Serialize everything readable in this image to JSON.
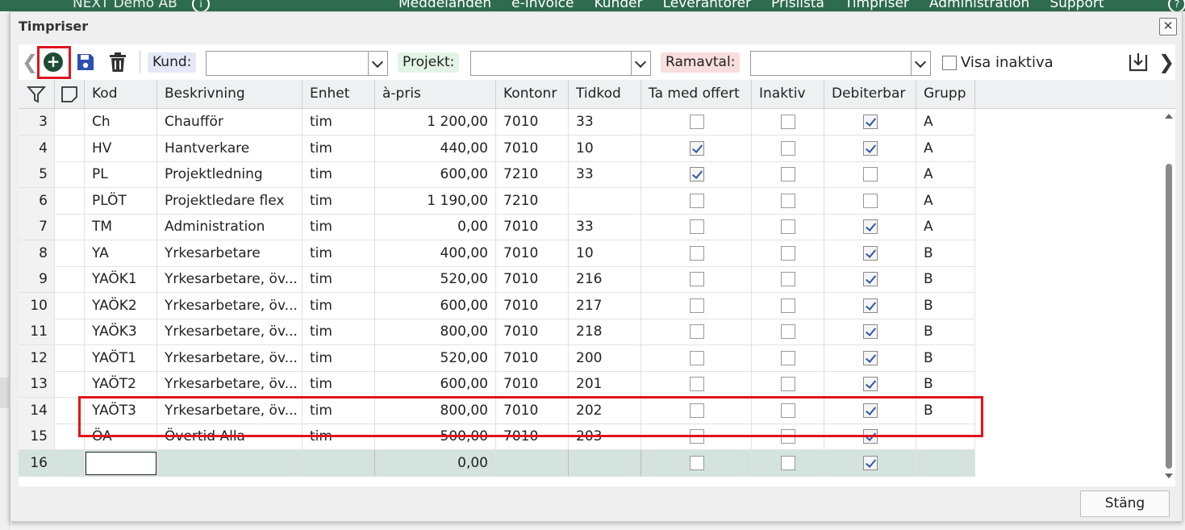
{
  "app_nav": {
    "company": "NEXT Demo AB",
    "menu": [
      "Meddelanden",
      "e-Invoice",
      "Kunder",
      "Leverantörer",
      "Prislista",
      "Timpriser",
      "Administration",
      "Support"
    ]
  },
  "dialog": {
    "title": "Timpriser",
    "close_label": "✕"
  },
  "toolbar": {
    "kund_label": "Kund:",
    "kund_value": "",
    "projekt_label": "Projekt:",
    "projekt_value": "",
    "ramavtal_label": "Ramavtal:",
    "ramavtal_value": "",
    "visa_inaktiva_label": "Visa inaktiva",
    "visa_inaktiva_checked": false
  },
  "grid": {
    "columns": [
      "Kod",
      "Beskrivning",
      "Enhet",
      "à-pris",
      "Kontonr",
      "Tidkod",
      "Ta med offert",
      "Inaktiv",
      "Debiterbar",
      "Grupp"
    ],
    "rows": [
      {
        "n": "3",
        "kod": "Ch",
        "beskrivning": "Chaufför",
        "enhet": "tim",
        "pris": "1 200,00",
        "kontonr": "7010",
        "tidkod": "33",
        "offert": false,
        "inaktiv": false,
        "debiterbar": true,
        "grupp": "A"
      },
      {
        "n": "4",
        "kod": "HV",
        "beskrivning": "Hantverkare",
        "enhet": "tim",
        "pris": "440,00",
        "kontonr": "7010",
        "tidkod": "10",
        "offert": true,
        "inaktiv": false,
        "debiterbar": true,
        "grupp": "A"
      },
      {
        "n": "5",
        "kod": "PL",
        "beskrivning": "Projektledning",
        "enhet": "tim",
        "pris": "600,00",
        "kontonr": "7210",
        "tidkod": "33",
        "offert": true,
        "inaktiv": false,
        "debiterbar": false,
        "grupp": "A"
      },
      {
        "n": "6",
        "kod": "PLÖT",
        "beskrivning": "Projektledare flex",
        "enhet": "tim",
        "pris": "1 190,00",
        "kontonr": "7210",
        "tidkod": "",
        "offert": false,
        "inaktiv": false,
        "debiterbar": false,
        "grupp": "A"
      },
      {
        "n": "7",
        "kod": "TM",
        "beskrivning": "Administration",
        "enhet": "tim",
        "pris": "0,00",
        "kontonr": "7010",
        "tidkod": "33",
        "offert": false,
        "inaktiv": false,
        "debiterbar": true,
        "grupp": "A"
      },
      {
        "n": "8",
        "kod": "YA",
        "beskrivning": "Yrkesarbetare",
        "enhet": "tim",
        "pris": "400,00",
        "kontonr": "7010",
        "tidkod": "10",
        "offert": false,
        "inaktiv": false,
        "debiterbar": true,
        "grupp": "B"
      },
      {
        "n": "9",
        "kod": "YAÖK1",
        "beskrivning": "Yrkesarbetare, öv...",
        "enhet": "tim",
        "pris": "520,00",
        "kontonr": "7010",
        "tidkod": "216",
        "offert": false,
        "inaktiv": false,
        "debiterbar": true,
        "grupp": "B"
      },
      {
        "n": "10",
        "kod": "YAÖK2",
        "beskrivning": "Yrkesarbetare, öv...",
        "enhet": "tim",
        "pris": "600,00",
        "kontonr": "7010",
        "tidkod": "217",
        "offert": false,
        "inaktiv": false,
        "debiterbar": true,
        "grupp": "B"
      },
      {
        "n": "11",
        "kod": "YAÖK3",
        "beskrivning": "Yrkesarbetare, öv...",
        "enhet": "tim",
        "pris": "800,00",
        "kontonr": "7010",
        "tidkod": "218",
        "offert": false,
        "inaktiv": false,
        "debiterbar": true,
        "grupp": "B"
      },
      {
        "n": "12",
        "kod": "YAÖT1",
        "beskrivning": "Yrkesarbetare, öv...",
        "enhet": "tim",
        "pris": "520,00",
        "kontonr": "7010",
        "tidkod": "200",
        "offert": false,
        "inaktiv": false,
        "debiterbar": true,
        "grupp": "B"
      },
      {
        "n": "13",
        "kod": "YAÖT2",
        "beskrivning": "Yrkesarbetare, öv...",
        "enhet": "tim",
        "pris": "600,00",
        "kontonr": "7010",
        "tidkod": "201",
        "offert": false,
        "inaktiv": false,
        "debiterbar": true,
        "grupp": "B"
      },
      {
        "n": "14",
        "kod": "YAÖT3",
        "beskrivning": "Yrkesarbetare, öv...",
        "enhet": "tim",
        "pris": "800,00",
        "kontonr": "7010",
        "tidkod": "202",
        "offert": false,
        "inaktiv": false,
        "debiterbar": true,
        "grupp": "B"
      },
      {
        "n": "15",
        "kod": "ÖA",
        "beskrivning": "Övertid Alla",
        "enhet": "tim",
        "pris": "500,00",
        "kontonr": "7010",
        "tidkod": "203",
        "offert": false,
        "inaktiv": false,
        "debiterbar": true,
        "grupp": ""
      }
    ],
    "new_row": {
      "n": "16",
      "kod": "",
      "beskrivning": "",
      "enhet": "",
      "pris": "0,00",
      "kontonr": "",
      "tidkod": "",
      "offert": false,
      "inaktiv": false,
      "debiterbar": true,
      "grupp": ""
    }
  },
  "footer": {
    "close_button": "Stäng"
  },
  "colors": {
    "accent": "#1c4d33",
    "highlight": "#e0141e",
    "new_row_bg": "#d4e3dd"
  },
  "icons": [
    "chevron-left-icon",
    "add-icon",
    "save-icon",
    "trash-icon",
    "download-icon",
    "chevron-right-icon",
    "filter-icon",
    "note-icon"
  ]
}
